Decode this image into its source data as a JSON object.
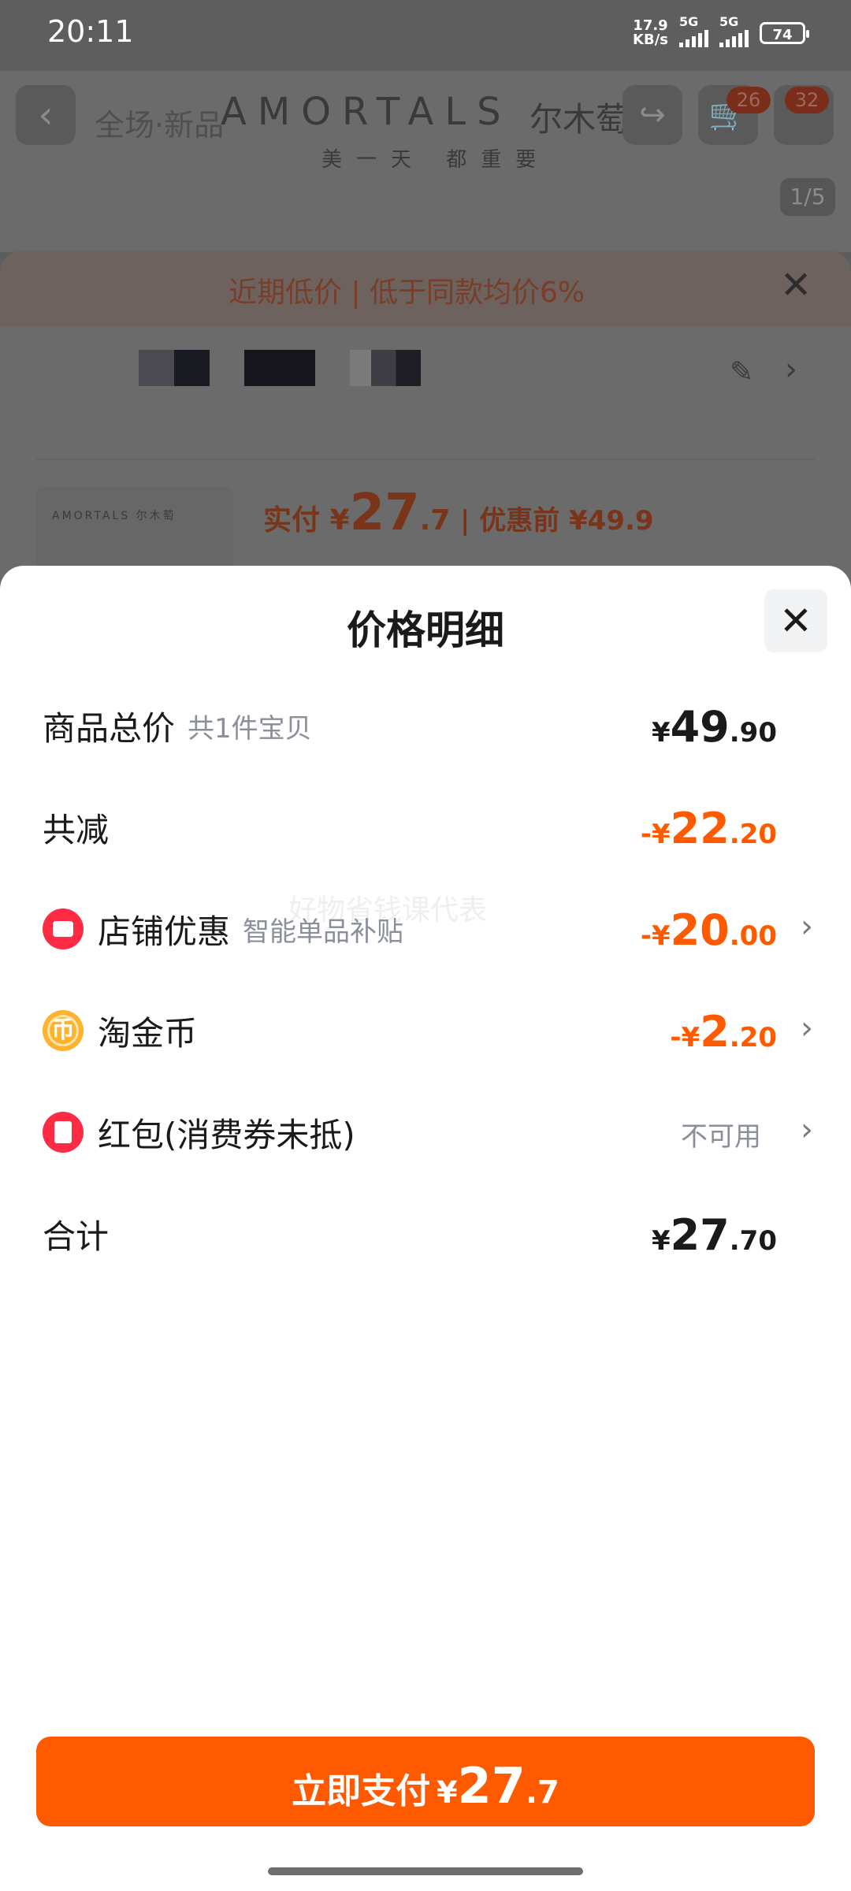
{
  "status_bar": {
    "time": "20:11",
    "net_speed_value": "17.9",
    "net_speed_unit": "KB/s",
    "signal1_label": "5G",
    "signal2_label": "5G",
    "battery": "74"
  },
  "background": {
    "brand": "AMORTALS",
    "brand_cn": "尔木萄",
    "slogan": "美一天 都重要",
    "ghost_text": "全场·新品",
    "cart_badge": "26",
    "more_badge": "32",
    "image_counter": "1/5",
    "banner_text": "近期低价 | 低于同款均价6%",
    "product_logo": "AMORTALS 尔木萄",
    "price_prefix": "实付 ¥",
    "price_int": "27",
    "price_dec": ".7",
    "price_before": "| 优惠前 ¥49.9"
  },
  "sheet": {
    "title": "价格明细",
    "watermark": "好物省钱课代表",
    "rows": {
      "total": {
        "label": "商品总价",
        "sub": "共1件宝贝",
        "sym": "¥",
        "int": "49",
        "dec": ".90"
      },
      "discount": {
        "label": "共减",
        "sym": "-¥",
        "int": "22",
        "dec": ".20"
      },
      "store": {
        "label": "店铺优惠",
        "sub": "智能单品补贴",
        "sym": "-¥",
        "int": "20",
        "dec": ".00"
      },
      "coins": {
        "label": "淘金币",
        "sym": "-¥",
        "int": "2",
        "dec": ".20"
      },
      "redpack": {
        "label": "红包(消费券未抵)",
        "status": "不可用"
      },
      "sum": {
        "label": "合计",
        "sym": "¥",
        "int": "27",
        "dec": ".70"
      }
    },
    "pay_button": {
      "label": "立即支付",
      "sym": "¥",
      "int": "27",
      "dec": ".7"
    }
  },
  "colors": {
    "accent": "#ff5a00",
    "red_icon": "#ff2b44",
    "coin_icon": "#ffb22e"
  },
  "icons": [
    "back-icon",
    "share-icon",
    "cart-icon",
    "close-icon",
    "shop-icon",
    "coin-icon",
    "red-packet-icon",
    "chevron-right-icon",
    "edit-icon"
  ]
}
